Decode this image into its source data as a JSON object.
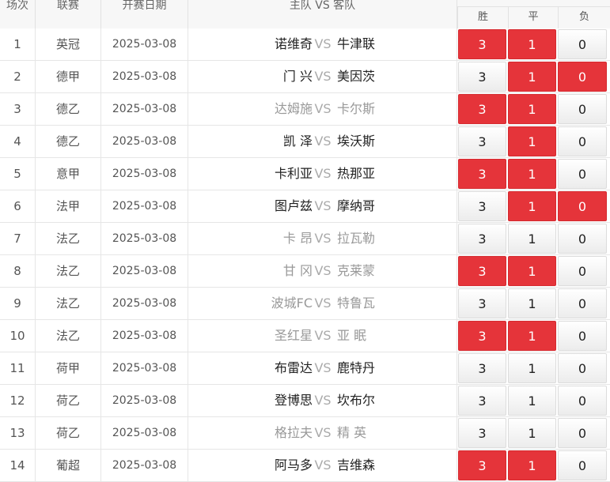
{
  "header": {
    "no": "场次",
    "league": "联赛",
    "date": "开赛日期",
    "teams": "主队 VS 客队",
    "win": "胜",
    "draw": "平",
    "lose": "负"
  },
  "colors": {
    "selected": "#e5343a",
    "muted_team": "#999999",
    "vs": "#aaaaaa"
  },
  "rows": [
    {
      "no": "1",
      "league": "英冠",
      "date": "2025-03-08",
      "home": "诺维奇",
      "vs": "VS",
      "away": "牛津联",
      "win": "3",
      "draw": "1",
      "lose": "0",
      "win_on": true,
      "draw_on": true,
      "lose_on": false,
      "muted": false
    },
    {
      "no": "2",
      "league": "德甲",
      "date": "2025-03-08",
      "home": "门 兴",
      "vs": "VS",
      "away": "美因茨",
      "win": "3",
      "draw": "1",
      "lose": "0",
      "win_on": false,
      "draw_on": true,
      "lose_on": true,
      "muted": false
    },
    {
      "no": "3",
      "league": "德乙",
      "date": "2025-03-08",
      "home": "达姆施",
      "vs": "VS",
      "away": "卡尔斯",
      "win": "3",
      "draw": "1",
      "lose": "0",
      "win_on": true,
      "draw_on": true,
      "lose_on": false,
      "muted": true
    },
    {
      "no": "4",
      "league": "德乙",
      "date": "2025-03-08",
      "home": "凯 泽",
      "vs": "VS",
      "away": "埃沃斯",
      "win": "3",
      "draw": "1",
      "lose": "0",
      "win_on": false,
      "draw_on": true,
      "lose_on": false,
      "muted": false
    },
    {
      "no": "5",
      "league": "意甲",
      "date": "2025-03-08",
      "home": "卡利亚",
      "vs": "VS",
      "away": "热那亚",
      "win": "3",
      "draw": "1",
      "lose": "0",
      "win_on": true,
      "draw_on": true,
      "lose_on": false,
      "muted": false
    },
    {
      "no": "6",
      "league": "法甲",
      "date": "2025-03-08",
      "home": "图卢兹",
      "vs": "VS",
      "away": "摩纳哥",
      "win": "3",
      "draw": "1",
      "lose": "0",
      "win_on": false,
      "draw_on": true,
      "lose_on": true,
      "muted": false
    },
    {
      "no": "7",
      "league": "法乙",
      "date": "2025-03-08",
      "home": "卡 昂",
      "vs": "VS",
      "away": "拉瓦勒",
      "win": "3",
      "draw": "1",
      "lose": "0",
      "win_on": false,
      "draw_on": false,
      "lose_on": false,
      "muted": true
    },
    {
      "no": "8",
      "league": "法乙",
      "date": "2025-03-08",
      "home": "甘 冈",
      "vs": "VS",
      "away": "克莱蒙",
      "win": "3",
      "draw": "1",
      "lose": "0",
      "win_on": true,
      "draw_on": true,
      "lose_on": false,
      "muted": true
    },
    {
      "no": "9",
      "league": "法乙",
      "date": "2025-03-08",
      "home": "波城FC",
      "vs": "VS",
      "away": "特鲁瓦",
      "win": "3",
      "draw": "1",
      "lose": "0",
      "win_on": false,
      "draw_on": false,
      "lose_on": false,
      "muted": true
    },
    {
      "no": "10",
      "league": "法乙",
      "date": "2025-03-08",
      "home": "圣红星",
      "vs": "VS",
      "away": "亚 眠",
      "win": "3",
      "draw": "1",
      "lose": "0",
      "win_on": true,
      "draw_on": true,
      "lose_on": false,
      "muted": true
    },
    {
      "no": "11",
      "league": "荷甲",
      "date": "2025-03-08",
      "home": "布雷达",
      "vs": "VS",
      "away": "鹿特丹",
      "win": "3",
      "draw": "1",
      "lose": "0",
      "win_on": false,
      "draw_on": false,
      "lose_on": false,
      "muted": false
    },
    {
      "no": "12",
      "league": "荷乙",
      "date": "2025-03-08",
      "home": "登博思",
      "vs": "VS",
      "away": "坎布尔",
      "win": "3",
      "draw": "1",
      "lose": "0",
      "win_on": false,
      "draw_on": false,
      "lose_on": false,
      "muted": false
    },
    {
      "no": "13",
      "league": "荷乙",
      "date": "2025-03-08",
      "home": "格拉夫",
      "vs": "VS",
      "away": "精 英",
      "win": "3",
      "draw": "1",
      "lose": "0",
      "win_on": false,
      "draw_on": false,
      "lose_on": false,
      "muted": true
    },
    {
      "no": "14",
      "league": "葡超",
      "date": "2025-03-08",
      "home": "阿马多",
      "vs": "VS",
      "away": "吉维森",
      "win": "3",
      "draw": "1",
      "lose": "0",
      "win_on": true,
      "draw_on": true,
      "lose_on": false,
      "muted": false
    }
  ]
}
